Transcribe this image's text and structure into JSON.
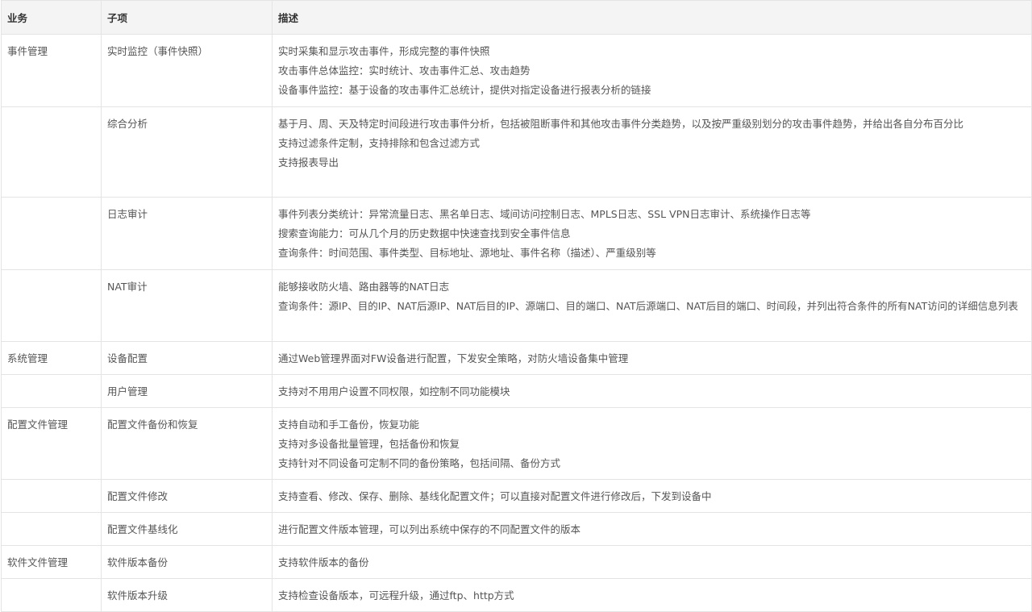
{
  "headers": [
    "业务",
    "子项",
    "描述"
  ],
  "rows": [
    {
      "cat": "事件管理",
      "sub": "实时监控（事件快照）",
      "desc": [
        "实时采集和显示攻击事件，形成完整的事件快照",
        "攻击事件总体监控：实时统计、攻击事件汇总、攻击趋势",
        "设备事件监控：基于设备的攻击事件汇总统计，提供对指定设备进行报表分析的链接"
      ]
    },
    {
      "cat": "",
      "sub": "综合分析",
      "desc": [
        "基于月、周、天及特定时间段进行攻击事件分析，包括被阻断事件和其他攻击事件分类趋势，以及按严重级别划分的攻击事件趋势，并给出各自分布百分比",
        "支持过滤条件定制，支持排除和包含过滤方式",
        "支持报表导出"
      ]
    },
    {
      "cat": "",
      "sub": "日志审计",
      "desc": [
        "事件列表分类统计：异常流量日志、黑名单日志、域间访问控制日志、MPLS日志、SSL VPN日志审计、系统操作日志等",
        "搜索查询能力：可从几个月的历史数据中快速查找到安全事件信息",
        "查询条件：时间范围、事件类型、目标地址、源地址、事件名称（描述）、严重级别等"
      ]
    },
    {
      "cat": "",
      "sub": "NAT审计",
      "desc": [
        "能够接收防火墙、路由器等的NAT日志",
        "查询条件：源IP、目的IP、NAT后源IP、NAT后目的IP、源端口、目的端口、NAT后源端口、NAT后目的端口、时间段，并列出符合条件的所有NAT访问的详细信息列表"
      ]
    },
    {
      "cat": "系统管理",
      "sub": "设备配置",
      "desc": [
        "通过Web管理界面对FW设备进行配置，下发安全策略，对防火墙设备集中管理"
      ]
    },
    {
      "cat": "",
      "sub": "用户管理",
      "desc": [
        "支持对不用用户设置不同权限，如控制不同功能模块"
      ]
    },
    {
      "cat": "配置文件管理",
      "sub": "配置文件备份和恢复",
      "desc": [
        "支持自动和手工备份，恢复功能",
        "支持对多设备批量管理，包括备份和恢复",
        "支持针对不同设备可定制不同的备份策略，包括间隔、备份方式"
      ]
    },
    {
      "cat": "",
      "sub": "配置文件修改",
      "desc": [
        "支持查看、修改、保存、删除、基线化配置文件；可以直接对配置文件进行修改后，下发到设备中"
      ]
    },
    {
      "cat": "",
      "sub": "配置文件基线化",
      "desc": [
        "进行配置文件版本管理，可以列出系统中保存的不同配置文件的版本"
      ]
    },
    {
      "cat": "软件文件管理",
      "sub": "软件版本备份",
      "desc": [
        "支持软件版本的备份"
      ]
    },
    {
      "cat": "",
      "sub": "软件版本升级",
      "desc": [
        "支持检查设备版本，可远程升级，通过ftp、http方式"
      ]
    }
  ]
}
